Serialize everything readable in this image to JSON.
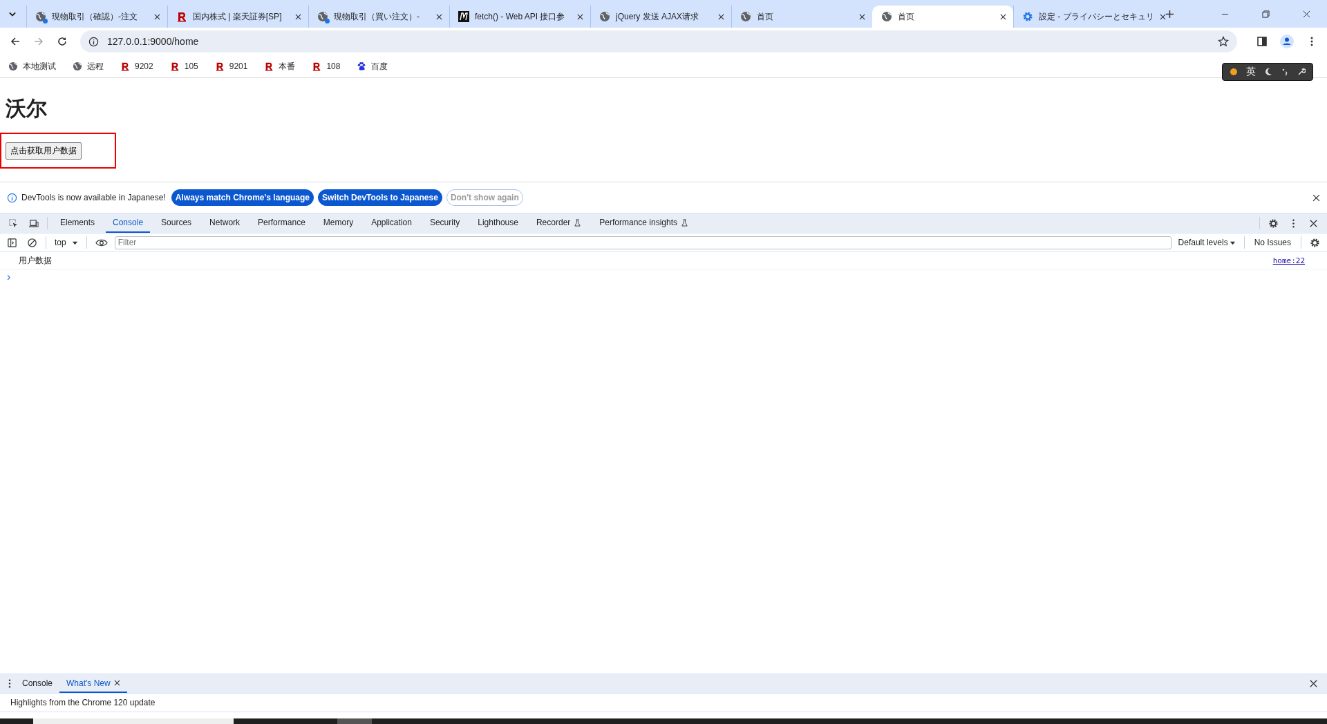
{
  "browser": {
    "tabs": [
      {
        "title": "現物取引（確認）-注文",
        "kind": "globe",
        "dot": true,
        "selected": false
      },
      {
        "title": "国内株式 | 楽天証券[SP]",
        "kind": "r",
        "selected": false
      },
      {
        "title": "現物取引（買い注文）-",
        "kind": "globe",
        "dot": true,
        "selected": false
      },
      {
        "title": "fetch() - Web API 接口参",
        "kind": "m",
        "selected": false
      },
      {
        "title": "jQuery 发送 AJAX请求",
        "kind": "globe",
        "dot": false,
        "selected": false
      },
      {
        "title": "首页",
        "kind": "globe",
        "dot": false,
        "selected": false
      },
      {
        "title": "首页",
        "kind": "globe",
        "dot": false,
        "selected": true
      },
      {
        "title": "設定 - プライバシーとセキュリ",
        "kind": "gear",
        "selected": false
      }
    ],
    "address": "127.0.0.1:9000/home",
    "bookmarks": [
      {
        "label": "本地测试",
        "kind": "globe"
      },
      {
        "label": "远程",
        "kind": "globe"
      },
      {
        "label": "9202",
        "kind": "r"
      },
      {
        "label": "105",
        "kind": "r"
      },
      {
        "label": "9201",
        "kind": "r"
      },
      {
        "label": "本番",
        "kind": "r"
      },
      {
        "label": "108",
        "kind": "r"
      },
      {
        "label": "百度",
        "kind": "paw"
      }
    ],
    "extension": {
      "label": "英"
    }
  },
  "page": {
    "heading": "沃尔",
    "button": "点击获取用户数据"
  },
  "devtools": {
    "infobar": {
      "message": "DevTools is now available in Japanese!",
      "buttons": [
        {
          "label": "Always match Chrome's language",
          "kind": "primary"
        },
        {
          "label": "Switch DevTools to Japanese",
          "kind": "primary"
        },
        {
          "label": "Don't show again",
          "kind": "outline"
        }
      ]
    },
    "tabs": [
      {
        "label": "Elements",
        "selected": false,
        "flask": false
      },
      {
        "label": "Console",
        "selected": true,
        "flask": false
      },
      {
        "label": "Sources",
        "selected": false,
        "flask": false
      },
      {
        "label": "Network",
        "selected": false,
        "flask": false
      },
      {
        "label": "Performance",
        "selected": false,
        "flask": false
      },
      {
        "label": "Memory",
        "selected": false,
        "flask": false
      },
      {
        "label": "Application",
        "selected": false,
        "flask": false
      },
      {
        "label": "Security",
        "selected": false,
        "flask": false
      },
      {
        "label": "Lighthouse",
        "selected": false,
        "flask": false
      },
      {
        "label": "Recorder",
        "selected": false,
        "flask": true
      },
      {
        "label": "Performance insights",
        "selected": false,
        "flask": true
      }
    ],
    "context": "top",
    "filter_placeholder": "Filter",
    "levels": "Default levels",
    "issues": "No Issues",
    "logs": [
      {
        "text": "用户数据",
        "source": "home:22"
      }
    ],
    "prompt": "›",
    "drawer": {
      "tabs": [
        {
          "label": "Console",
          "selected": false,
          "closable": false
        },
        {
          "label": "What's New",
          "selected": true,
          "closable": true
        }
      ],
      "text": "Highlights from the Chrome 120 update"
    }
  }
}
